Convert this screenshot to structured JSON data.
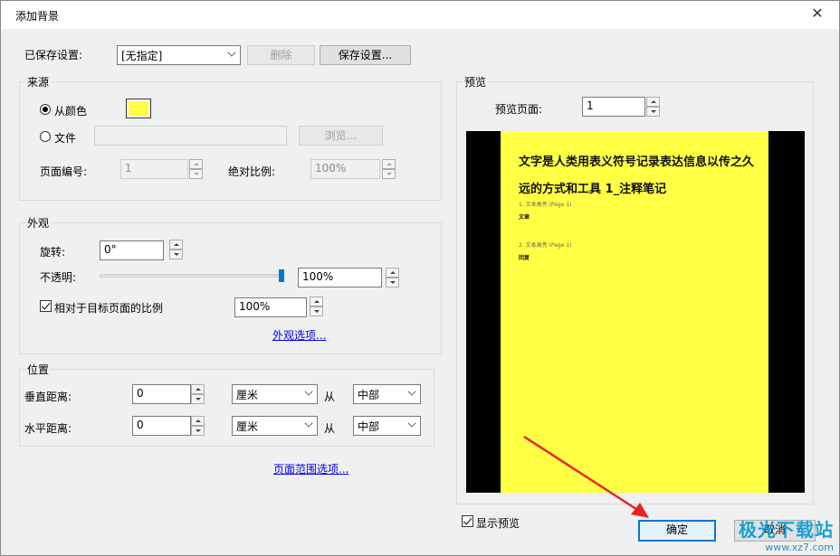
{
  "window": {
    "title": "添加背景"
  },
  "saved": {
    "label": "已保存设置:",
    "selected": "[无指定]",
    "delete_btn": "删除",
    "save_btn": "保存设置..."
  },
  "source": {
    "title": "来源",
    "from_color": "从颜色",
    "color": "#ffff44",
    "file": "文件",
    "browse_btn": "浏览...",
    "page_num_label": "页面编号:",
    "page_num": "1",
    "abs_scale_label": "绝对比例:",
    "abs_scale": "100%"
  },
  "appearance": {
    "title": "外观",
    "rotation_label": "旋转:",
    "rotation": "0°",
    "opacity_label": "不透明:",
    "opacity": "100%",
    "opacity_value": 1.0,
    "relative_label": "相对于目标页面的比例",
    "relative_value": "100%",
    "options_link": "外观选项..."
  },
  "position": {
    "title": "位置",
    "vertical_label": "垂直距离:",
    "vertical_value": "0",
    "vertical_unit": "厘米",
    "from_label_v": "从",
    "vertical_from": "中部",
    "horizontal_label": "水平距离:",
    "horizontal_value": "0",
    "horizontal_unit": "厘米",
    "from_label_h": "从",
    "horizontal_from": "中部"
  },
  "page_range_link": "页面范围选项...",
  "preview": {
    "title": "预览",
    "page_label": "预览页面:",
    "page": "1",
    "page_color": "#ffff44",
    "doc_title": "文字是人类用表义符号记录表达信息以传之久远的方式和工具 1_注释笔记",
    "item1_head": "1. 文本高亮 (Page 1)",
    "item1_text": "文章",
    "item2_head": "2. 文本高亮 (Page 1)",
    "item2_text": "回复",
    "show_preview": "显示预览"
  },
  "ok_btn": "确定",
  "cancel_btn": "取消",
  "watermark": {
    "main": "极光下载站",
    "sub": "www.xz7.com"
  }
}
